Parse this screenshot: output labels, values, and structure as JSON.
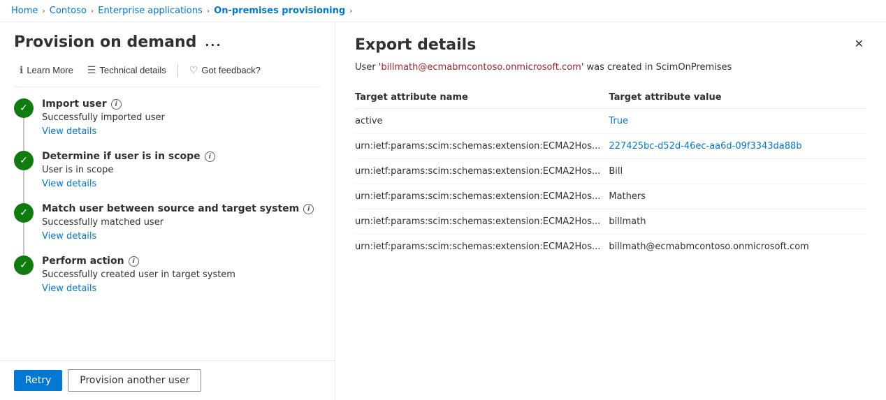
{
  "breadcrumb": {
    "items": [
      {
        "label": "Home",
        "active": false
      },
      {
        "label": "Contoso",
        "active": false
      },
      {
        "label": "Enterprise applications",
        "active": false
      },
      {
        "label": "On-premises provisioning",
        "active": true
      }
    ]
  },
  "left_panel": {
    "title": "Provision on demand",
    "ellipsis": "...",
    "toolbar": {
      "learn_more": "Learn More",
      "technical_details": "Technical details",
      "got_feedback": "Got feedback?"
    },
    "steps": [
      {
        "title": "Import user",
        "description": "Successfully imported user",
        "view_details": "View details",
        "status": "success"
      },
      {
        "title": "Determine if user is in scope",
        "description": "User is in scope",
        "view_details": "View details",
        "status": "success"
      },
      {
        "title": "Match user between source and target system",
        "description": "Successfully matched user",
        "view_details": "View details",
        "status": "success"
      },
      {
        "title": "Perform action",
        "description": "Successfully created user in target system",
        "view_details": "View details",
        "status": "success"
      }
    ],
    "buttons": {
      "retry": "Retry",
      "provision_another": "Provision another user"
    }
  },
  "right_panel": {
    "title": "Export details",
    "subtitle_prefix": "User '",
    "subtitle_user": "billmath@ecmabmcontoso.onmicrosoft.com",
    "subtitle_suffix": "' was created in ScimOnPremises",
    "table": {
      "col_name_header": "Target attribute name",
      "col_value_header": "Target attribute value",
      "rows": [
        {
          "name": "active",
          "value": "True",
          "value_style": "blue"
        },
        {
          "name": "urn:ietf:params:scim:schemas:extension:ECMA2Hos...",
          "value": "227425bc-d52d-46ec-aa6d-09f3343da88b",
          "value_style": "blue"
        },
        {
          "name": "urn:ietf:params:scim:schemas:extension:ECMA2Hos...",
          "value": "Bill",
          "value_style": "normal"
        },
        {
          "name": "urn:ietf:params:scim:schemas:extension:ECMA2Hos...",
          "value": "Mathers",
          "value_style": "normal"
        },
        {
          "name": "urn:ietf:params:scim:schemas:extension:ECMA2Hos...",
          "value": "billmath",
          "value_style": "normal"
        },
        {
          "name": "urn:ietf:params:scim:schemas:extension:ECMA2Hos...",
          "value": "billmath@ecmabmcontoso.onmicrosoft.com",
          "value_style": "normal"
        }
      ]
    }
  },
  "icons": {
    "check": "✓",
    "info": "i",
    "close": "✕",
    "learn_more_icon": "ℹ",
    "technical_details_icon": "☰",
    "feedback_icon": "♡",
    "chevron": "›",
    "ellipsis": "···"
  },
  "colors": {
    "success_green": "#107c10",
    "link_blue": "#0078d4",
    "value_blue": "#0078d4",
    "text_dark": "#323130",
    "border_light": "#edebe9"
  }
}
